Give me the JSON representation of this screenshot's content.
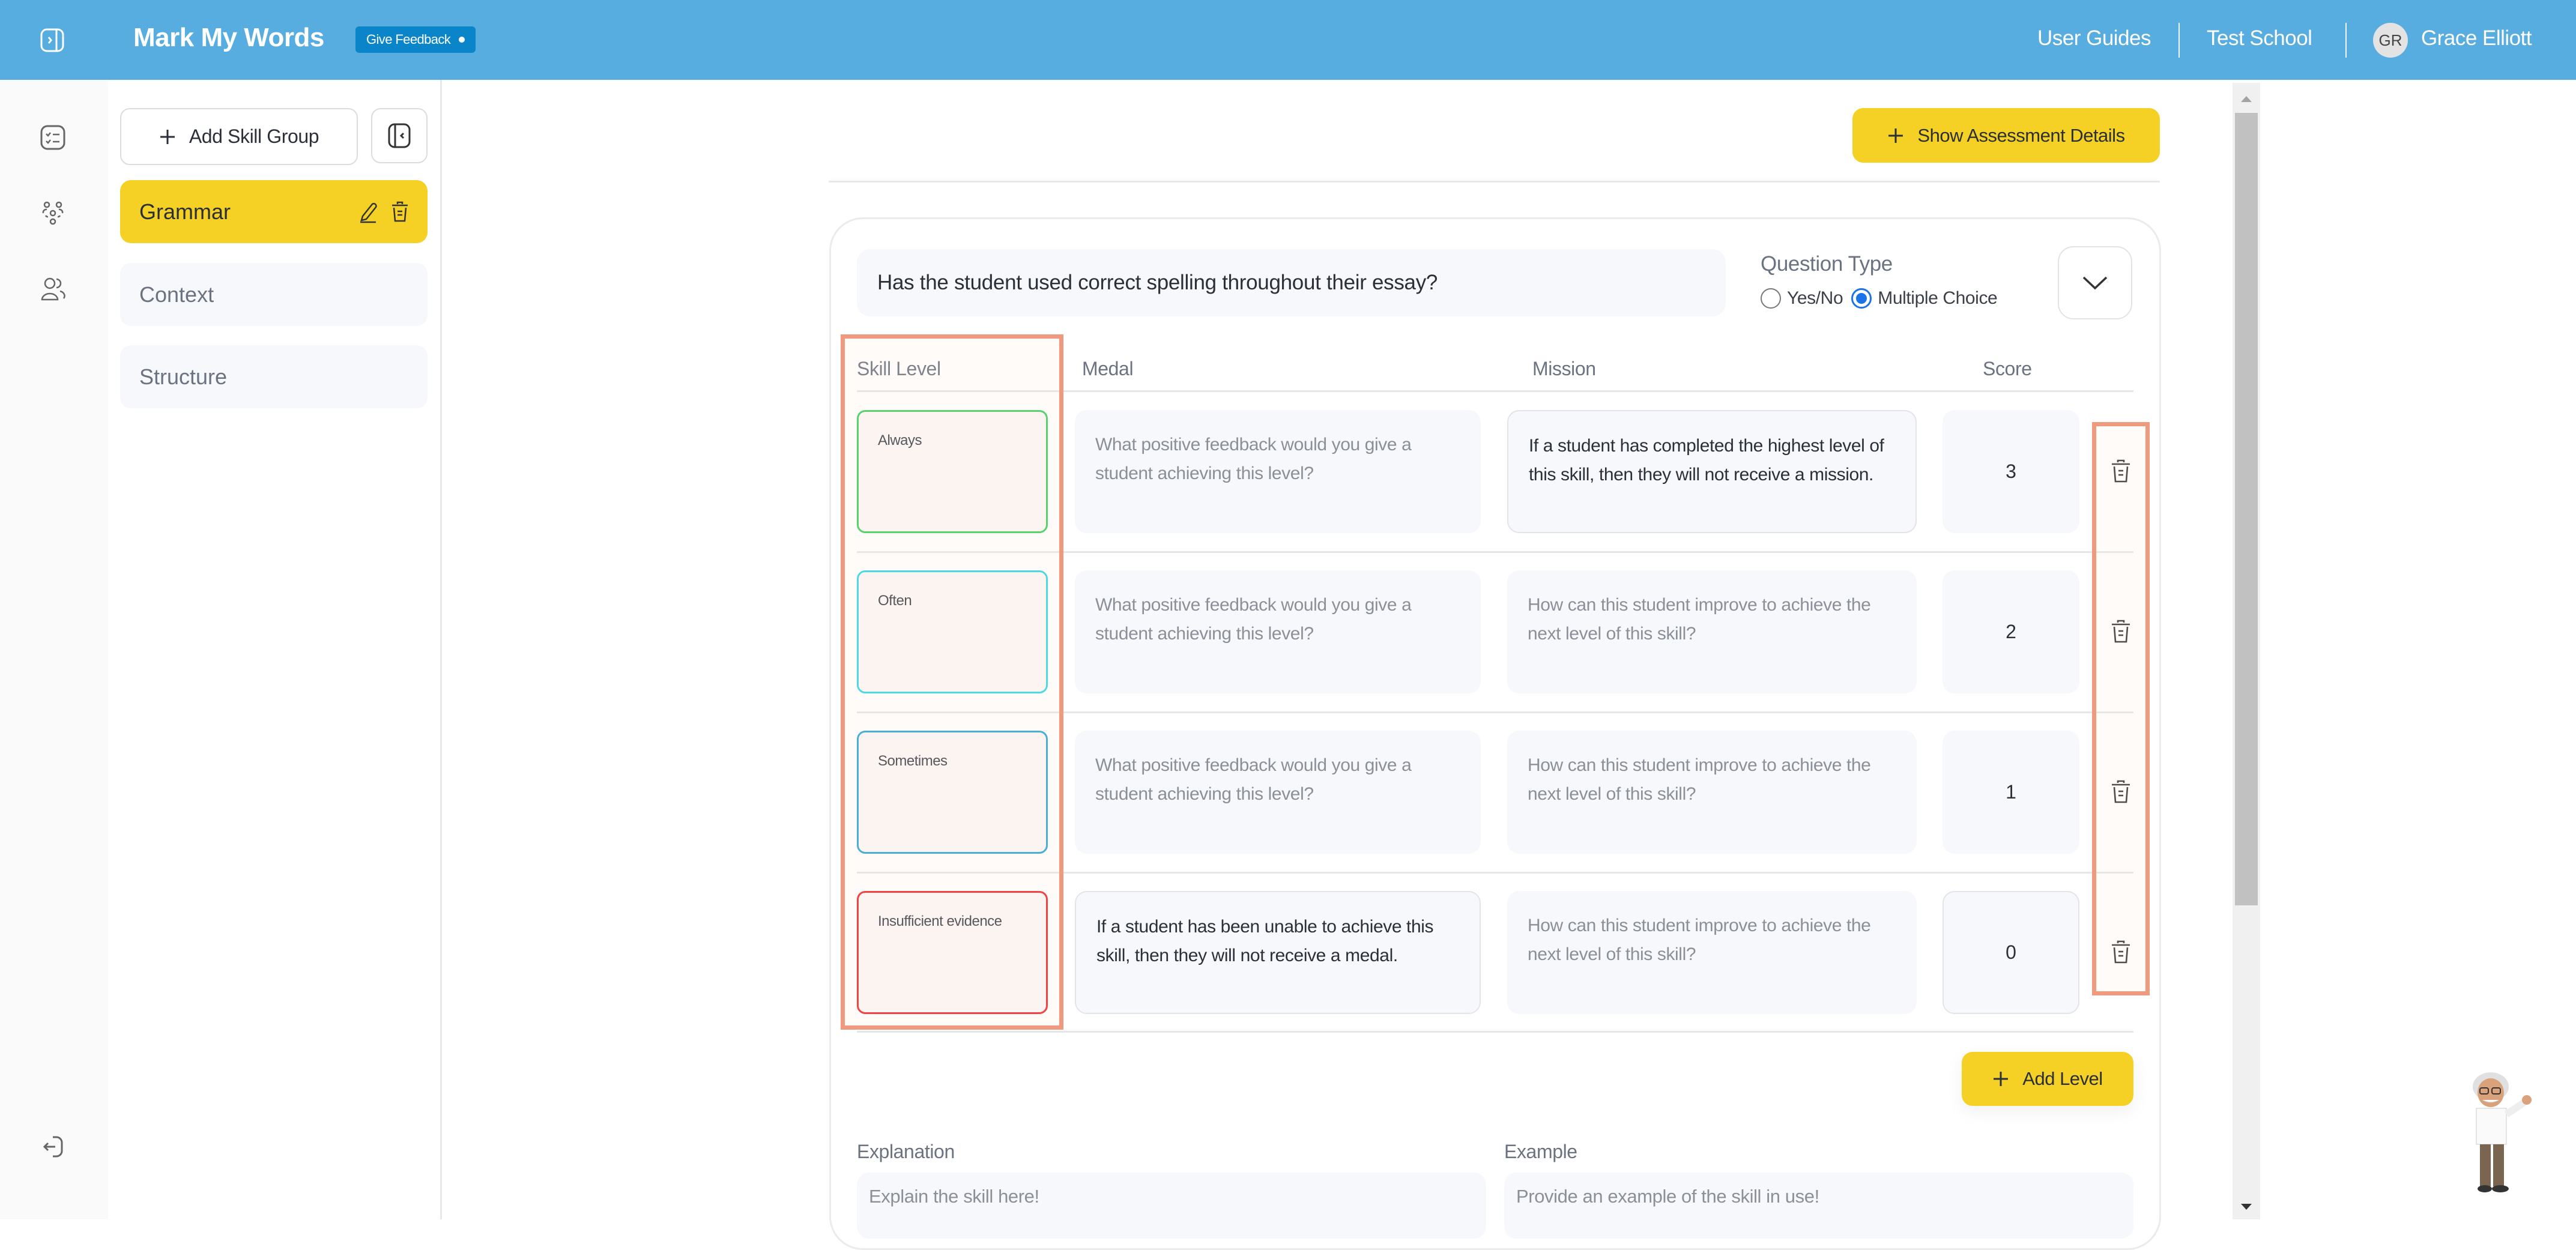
{
  "header": {
    "app_title": "Mark My Words",
    "feedback_label": "Give Feedback",
    "links": [
      "User Guides",
      "Test School"
    ],
    "user_initials": "GR",
    "user_name": "Grace Elliott",
    "brand_color": "#58ade0"
  },
  "rail": {
    "icons": [
      "assessments-icon",
      "skills-network-icon",
      "users-icon"
    ],
    "bottom_icon": "logout-icon"
  },
  "skill_groups": {
    "add_label": "Add Skill Group",
    "items": [
      {
        "label": "Grammar",
        "active": true
      },
      {
        "label": "Context",
        "active": false
      },
      {
        "label": "Structure",
        "active": false
      }
    ]
  },
  "main": {
    "show_details_label": "Show Assessment Details",
    "question": "Has the student used correct spelling throughout their essay?",
    "question_type": {
      "label": "Question Type",
      "options": [
        "Yes/No",
        "Multiple Choice"
      ],
      "selected": "Multiple Choice"
    },
    "columns": [
      "Skill Level",
      "Medal",
      "Mission",
      "Score"
    ],
    "levels": [
      {
        "skill_level": "Always",
        "border_color": "#3ccf5a",
        "medal": "What positive feedback would you give a student achieving this level?",
        "medal_is_placeholder": true,
        "mission": "If a student has completed the highest level of this skill, then they will not receive a mission.",
        "mission_is_placeholder": false,
        "score": "3"
      },
      {
        "skill_level": "Often",
        "border_color": "#2fd6e8",
        "medal": "What positive feedback would you give a student achieving this level?",
        "medal_is_placeholder": true,
        "mission": "How can this student improve to achieve the next level of this skill?",
        "mission_is_placeholder": true,
        "score": "2"
      },
      {
        "skill_level": "Sometimes",
        "border_color": "#2ba6d6",
        "medal": "What positive feedback would you give a student achieving this level?",
        "medal_is_placeholder": true,
        "mission": "How can this student improve to achieve the next level of this skill?",
        "mission_is_placeholder": true,
        "score": "1"
      },
      {
        "skill_level": "Insufficient evidence",
        "border_color": "#f0262b",
        "medal": "If a student has been unable to achieve this skill, then they will not receive a medal.",
        "medal_is_placeholder": false,
        "mission": "How can this student improve to achieve the next level of this skill?",
        "mission_is_placeholder": true,
        "score": "0"
      }
    ],
    "add_level_label": "Add Level",
    "explanation": {
      "label": "Explanation",
      "placeholder": "Explain the skill here!"
    },
    "example": {
      "label": "Example",
      "placeholder": "Provide an example of the skill in use!"
    }
  },
  "accent_colors": {
    "yellow": "#f5d125",
    "highlight": "#ef9a7e"
  }
}
